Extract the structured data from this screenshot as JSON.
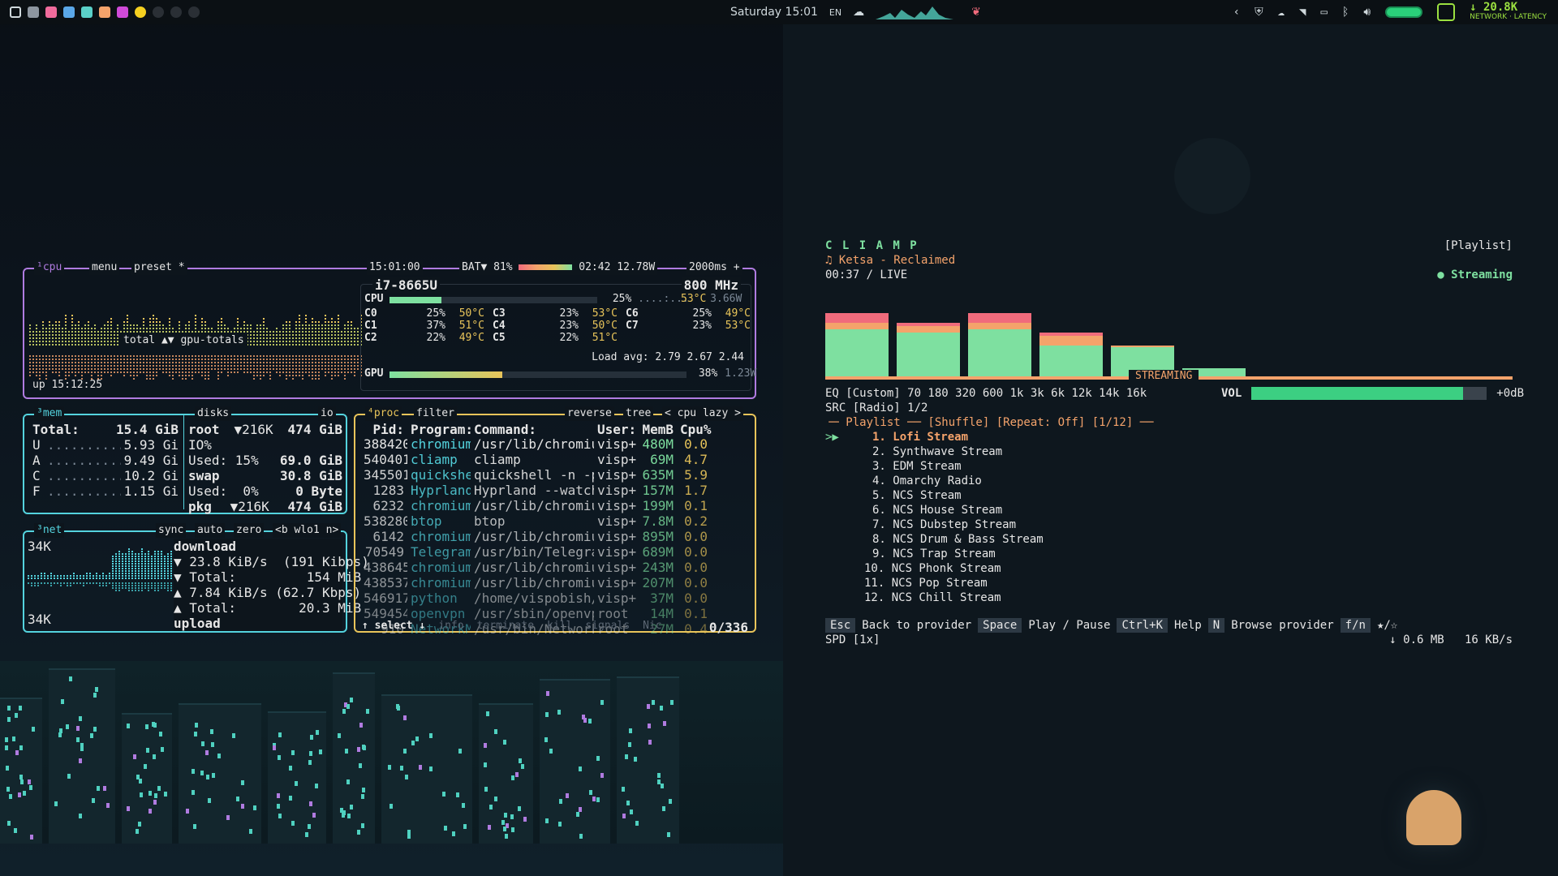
{
  "topbar": {
    "datetime": "Saturday 15:01",
    "lang": "EN",
    "network_speed": "↓ 20.8K",
    "network_label": "NETWORK · LATENCY"
  },
  "btop": {
    "cpu": {
      "tab": "¹cpu",
      "menu": "menu",
      "preset": "preset *",
      "time": "15:01:00",
      "battery": "BAT▼ 81%",
      "battery_time": "02:42 12.78W",
      "interval": "2000ms +",
      "model": "i7-8665U",
      "freq": "800 MHz",
      "cpu_total": "25%",
      "cpu_temp": "53°C",
      "cpu_power": "3.66W",
      "cores": [
        [
          "C0",
          "25%",
          "50°C",
          "C3",
          "23%",
          "53°C",
          "C6",
          "25%",
          "49°C"
        ],
        [
          "C1",
          "37%",
          "51°C",
          "C4",
          "23%",
          "50°C",
          "C7",
          "23%",
          "53°C"
        ],
        [
          "C2",
          "22%",
          "49°C",
          "C5",
          "22%",
          "51°C",
          "",
          "",
          ""
        ]
      ],
      "load": "Load avg: 2.79 2.67 2.44",
      "gpu": "38%",
      "gpu_power": "1.23W",
      "uptime": "up 15:12:25",
      "graph_label": "total ▲▼ gpu-totals"
    },
    "mem": {
      "tab": "³mem",
      "total_label": "Total:",
      "total": "15.4 GiB",
      "rows": [
        [
          "U",
          "5.93 Gi"
        ],
        [
          "A",
          "9.49 Gi"
        ],
        [
          "C",
          "10.2 Gi"
        ],
        [
          "F",
          "1.15 Gi"
        ]
      ]
    },
    "disks": {
      "tab": "disks",
      "io": "io",
      "rows": [
        [
          "root",
          "▼216K",
          "474 GiB"
        ],
        [
          "IO%",
          "",
          ""
        ],
        [
          "Used: 15%",
          "",
          "69.0 GiB"
        ],
        [
          "swap",
          "",
          "30.8 GiB"
        ],
        [
          "Used:  0%",
          "",
          "0 Byte"
        ],
        [
          "pkg",
          "▼216K",
          "474 GiB"
        ]
      ]
    },
    "net": {
      "tab": "³net",
      "sync": "sync",
      "auto": "auto",
      "zero": "zero",
      "iface": "<b wlo1 n>",
      "scale_top": "34K",
      "scale_bottom": "34K",
      "rows": [
        "download",
        "▼ 23.8 KiB/s  (191 Kibps)",
        "▼ Total:         154 MiB",
        "▲ 7.84 KiB/s (62.7 Kbps)",
        "▲ Total:        20.3 MiB",
        "upload"
      ]
    },
    "proc": {
      "tab": "⁴proc",
      "filter": "filter",
      "reverse": "reverse",
      "tree": "tree",
      "sort": "< cpu lazy >",
      "headers": [
        "Pid:",
        "Program:",
        "Command:",
        "User:",
        "MemB",
        "Cpu%"
      ],
      "rows": [
        [
          "388420",
          "chromium",
          "/usr/lib/chromium/",
          "visp+",
          "480M",
          "0.0"
        ],
        [
          "540401",
          "cliamp",
          "cliamp",
          "visp+",
          "69M",
          "4.7"
        ],
        [
          "345501",
          "quickshe",
          "quickshell -n -p /",
          "visp+",
          "635M",
          "5.9"
        ],
        [
          "1283",
          "Hyprland",
          "Hyprland --watchdo",
          "visp+",
          "157M",
          "1.7"
        ],
        [
          "6232",
          "chromium",
          "/usr/lib/chromium/",
          "visp+",
          "199M",
          "0.1"
        ],
        [
          "538280",
          "btop",
          "btop",
          "visp+",
          "7.8M",
          "0.2"
        ],
        [
          "6142",
          "chromium",
          "/usr/lib/chromium/",
          "visp+",
          "895M",
          "0.0"
        ],
        [
          "70549",
          "Telegram",
          "/usr/bin/Telegram",
          "visp+",
          "689M",
          "0.0"
        ],
        [
          "438645",
          "chromium",
          "/usr/lib/chromium/",
          "visp+",
          "243M",
          "0.0"
        ],
        [
          "438537",
          "chromium",
          "/usr/lib/chromium/",
          "visp+",
          "207M",
          "0.0"
        ],
        [
          "546917",
          "python",
          "/home/vispobish/.l",
          "visp+",
          "37M",
          "0.0"
        ],
        [
          "549454",
          "openvpn",
          "/usr/sbin/openvpn",
          "root",
          "14M",
          "0.1"
        ],
        [
          "910",
          "NetworkM",
          "/usr/bin/NetworkMa",
          "root",
          "27M",
          "0.4"
        ]
      ],
      "footer": [
        "↑ select ↓",
        "info",
        "terminate",
        "kill",
        "signals",
        "Nic"
      ],
      "count": "0/336"
    }
  },
  "cliamp": {
    "title": "C L I A M P",
    "view": "[Playlist]",
    "track": "♫ Ketsa - Reclaimed",
    "time": "00:37 / LIVE",
    "status": "● Streaming",
    "streaming_label": "STREAMING",
    "eq": "EQ [Custom] 70 180 320 600 1k 3k 6k 12k 14k 16k",
    "vol_label": "VOL",
    "vol_value": "+0dB",
    "volume_level": 0.9,
    "src": "SRC [Radio] 1/2",
    "playlist_header": "╶─ Playlist ── [Shuffle] [Repeat: Off] [1/12] ──",
    "cursor": ">▶",
    "playlist": [
      "1. Lofi Stream",
      "2. Synthwave Stream",
      "3. EDM Stream",
      "4. Omarchy Radio",
      "5. NCS Stream",
      "6. NCS House Stream",
      "7. NCS Dubstep Stream",
      "8. NCS Drum & Bass Stream",
      "9. NCS Trap Stream",
      "10. NCS Phonk Stream",
      "11. NCS Pop Stream",
      "12. NCS Chill Stream"
    ],
    "help": {
      "esc": "Esc",
      "esc_text": "Back to provider",
      "space": "Space",
      "space_text": "Play / Pause",
      "ctrlk": "Ctrl+K",
      "ctrlk_text": "Help",
      "n": "N",
      "n_text": "Browse provider",
      "fn": "f/n",
      "fn_text": "★/☆"
    },
    "spd": "SPD [1x]",
    "download_stats": "↓ 0.6 MB   16 KB/s"
  }
}
